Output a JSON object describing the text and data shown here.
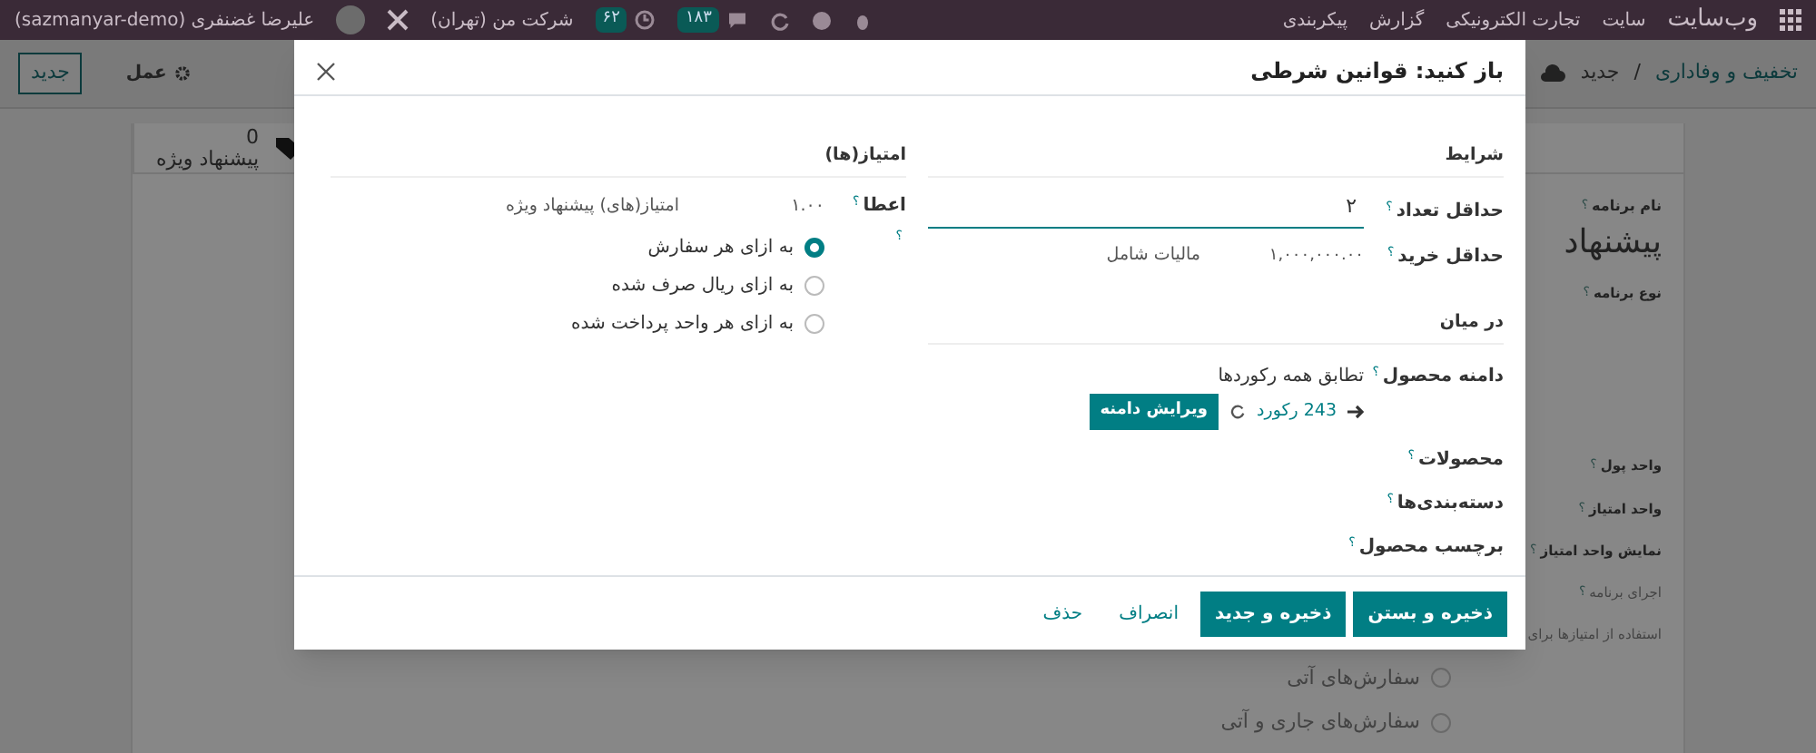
{
  "navbar": {
    "brand": "وب‌سایت",
    "menu": [
      "سایت",
      "تجارت الکترونیکی",
      "گزارش",
      "پیکربندی"
    ],
    "counters": [
      {
        "kind": "chat",
        "count": "۱۸۳"
      },
      {
        "kind": "clock",
        "count": "۶۲"
      }
    ],
    "company": "شرکت من (تهران)",
    "user": "علیرضا غضنفری (sazmanyar-demo)"
  },
  "control_panel": {
    "breadcrumb": "تخفیف و وفاداری",
    "separator": "/",
    "current": "جدید",
    "action": "عمل",
    "new_button": "جدید"
  },
  "smart_button": {
    "count": "0",
    "label": "پیشنهاد ویژه"
  },
  "form": {
    "name_label": "نام برنامه",
    "name_value": "پیشنهاد",
    "hint": "؟",
    "fields": [
      "نوع برنامه",
      "واحد پول",
      "واحد امتیاز",
      "نمایش واحد امتیاز",
      "اجرای برنامه",
      "استفاده از امتیازها برای"
    ],
    "options": [
      {
        "label": "سفارش‌های آتی",
        "selected": false
      },
      {
        "label": "سفارش‌های جاری و آتی",
        "selected": false
      }
    ]
  },
  "dialog": {
    "title": "باز کنید: قوانین شرطی",
    "conditions": {
      "title": "شرایط",
      "min_qty": {
        "label": "حداقل تعداد",
        "value": "۲"
      },
      "min_amount": {
        "label": "حداقل خرید",
        "value": "۱,۰۰۰,۰۰۰.۰۰",
        "tax": "مالیات شامل"
      }
    },
    "among": {
      "title": "در میان",
      "domain_label": "دامنه محصول",
      "domain_value": "تطابق همه رکوردها",
      "records": "243 رکورد",
      "edit_domain": "ویرایش دامنه",
      "fields": [
        "محصولات",
        "دسته‌بندی‌ها",
        "برچسب محصول"
      ]
    },
    "points": {
      "title": "امتیاز(ها)",
      "grant_label": "اعطا",
      "amount": "۱.۰۰",
      "unit": "امتیاز(های) پیشنهاد ویژه",
      "modes": [
        {
          "label": "به ازای هر سفارش",
          "selected": true
        },
        {
          "label": "به ازای ریال صرف شده",
          "selected": false
        },
        {
          "label": "به ازای هر واحد پرداخت شده",
          "selected": false
        }
      ]
    },
    "buttons": [
      {
        "kind": "primary",
        "label": "ذخیره و بستن"
      },
      {
        "kind": "primary",
        "label": "ذخیره و جدید"
      },
      {
        "kind": "link",
        "label": "انصراف"
      },
      {
        "kind": "link",
        "label": "حذف"
      }
    ]
  }
}
